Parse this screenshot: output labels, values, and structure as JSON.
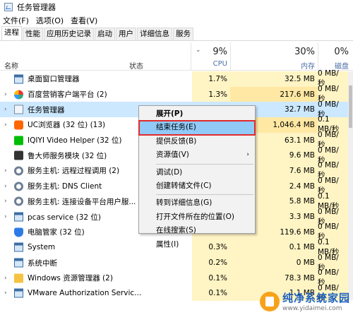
{
  "window": {
    "title": "任务管理器"
  },
  "menu": {
    "items": [
      "文件(F)",
      "选项(O)",
      "查看(V)"
    ]
  },
  "tabs": [
    "进程",
    "性能",
    "应用历史记录",
    "启动",
    "用户",
    "详细信息",
    "服务"
  ],
  "columns": {
    "name": "名称",
    "status": "状态",
    "cpu_pct": "9%",
    "cpu_label": "CPU",
    "mem_pct": "30%",
    "mem_label": "内存",
    "disk_pct": "0%",
    "disk_label": "磁盘"
  },
  "processes": [
    {
      "name": "桌面窗口管理器",
      "cpu": "1.7%",
      "mem": "32.5 MB",
      "disk": "0 MB/秒",
      "icon": "window-icon",
      "expandable": false
    },
    {
      "name": "百度营销客户端平台 (2)",
      "cpu": "1.3%",
      "mem": "217.6 MB",
      "disk": "0 MB/秒",
      "icon": "baidu-icon",
      "expandable": true
    },
    {
      "name": "任务管理器",
      "cpu": "",
      "mem": "32.7 MB",
      "disk": "0 MB/秒",
      "icon": "task-manager-icon",
      "expandable": true,
      "selected": true
    },
    {
      "name": "UC浏览器 (32 位) (13)",
      "cpu": "",
      "mem": "1,046.4 MB",
      "disk": "0.1 MB/秒",
      "icon": "uc-browser-icon",
      "expandable": true
    },
    {
      "name": "IQIYI Video Helper (32 位)",
      "cpu": "",
      "mem": "63.1 MB",
      "disk": "0 MB/秒",
      "icon": "iqiyi-icon",
      "expandable": false
    },
    {
      "name": "鲁大师服务模块 (32 位)",
      "cpu": "",
      "mem": "9.6 MB",
      "disk": "0 MB/秒",
      "icon": "ludashi-icon",
      "expandable": false
    },
    {
      "name": "服务主机: 远程过程调用 (2)",
      "cpu": "",
      "mem": "7.6 MB",
      "disk": "0 MB/秒",
      "icon": "gear-icon",
      "expandable": true
    },
    {
      "name": "服务主机: DNS Client",
      "cpu": "",
      "mem": "2.4 MB",
      "disk": "0 MB/秒",
      "icon": "gear-icon",
      "expandable": true
    },
    {
      "name": "服务主机: 连接设备平台用户服...",
      "cpu": "",
      "mem": "5.8 MB",
      "disk": "0.1 MB/秒",
      "icon": "gear-icon",
      "expandable": true
    },
    {
      "name": "pcas service (32 位)",
      "cpu": "",
      "mem": "3.3 MB",
      "disk": "0 MB/秒",
      "icon": "window-icon",
      "expandable": true
    },
    {
      "name": "电脑管家 (32 位)",
      "cpu": "",
      "mem": "119.6 MB",
      "disk": "0 MB/秒",
      "icon": "shield-icon",
      "expandable": false
    },
    {
      "name": "System",
      "cpu": "0.3%",
      "mem": "0.1 MB",
      "disk": "0.1 MB/秒",
      "icon": "window-icon",
      "expandable": false
    },
    {
      "name": "系统中断",
      "cpu": "0.2%",
      "mem": "0 MB",
      "disk": "0 MB/秒",
      "icon": "window-icon",
      "expandable": false
    },
    {
      "name": "Windows 资源管理器 (2)",
      "cpu": "0.1%",
      "mem": "78.3 MB",
      "disk": "0 MB/秒",
      "icon": "folder-icon",
      "expandable": true
    },
    {
      "name": "VMware Authorization Servic...",
      "cpu": "0.1%",
      "mem": "1.1 MB",
      "disk": "0 MB/秒",
      "icon": "window-icon",
      "expandable": true
    }
  ],
  "context_menu": {
    "items": [
      {
        "label": "展开(P)",
        "bold": true
      },
      {
        "label": "结束任务(E)",
        "highlighted": true
      },
      {
        "label": "提供反馈(B)"
      },
      {
        "label": "资源值(V)",
        "submenu": true
      },
      {
        "separator": true
      },
      {
        "label": "调试(D)"
      },
      {
        "label": "创建转储文件(C)"
      },
      {
        "separator": true
      },
      {
        "label": "转到详细信息(G)"
      },
      {
        "label": "打开文件所在的位置(O)"
      },
      {
        "label": "在线搜索(S)"
      },
      {
        "label": "属性(I)"
      }
    ]
  },
  "watermark": {
    "title": "纯净系统家园",
    "url": "www.yidaimei.com"
  }
}
